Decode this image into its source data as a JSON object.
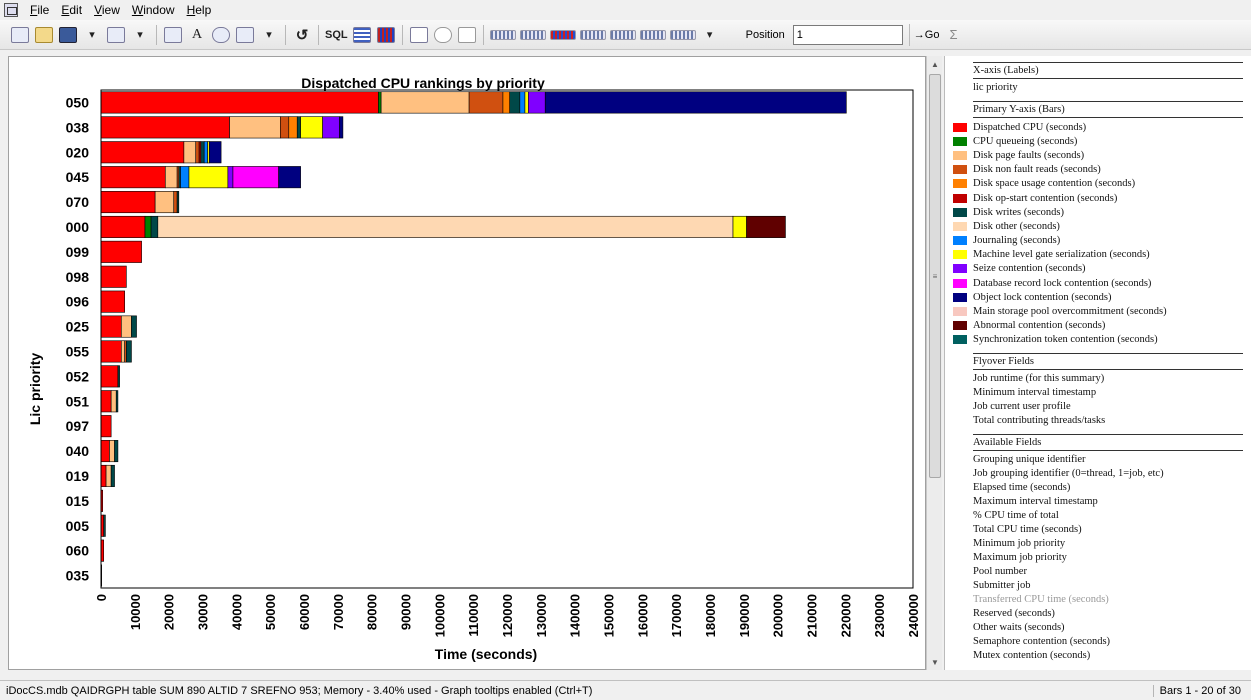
{
  "menu": [
    "File",
    "Edit",
    "View",
    "Window",
    "Help"
  ],
  "toolbar": {
    "sql_label": "SQL",
    "position_label": "Position",
    "position_value": "1",
    "go_label": "→Go",
    "sigma_label": "Σ"
  },
  "chart_data": {
    "type": "bar",
    "orientation": "horizontal",
    "stacked": true,
    "title": "Dispatched CPU rankings by priority",
    "xlabel": "Time (seconds)",
    "ylabel": "Lic priority",
    "xlim": [
      0,
      240000
    ],
    "x_ticks": [
      0,
      10000,
      20000,
      30000,
      40000,
      50000,
      60000,
      70000,
      80000,
      90000,
      100000,
      110000,
      120000,
      130000,
      140000,
      150000,
      160000,
      170000,
      180000,
      190000,
      200000,
      210000,
      220000,
      230000,
      240000
    ],
    "categories": [
      "050",
      "038",
      "020",
      "045",
      "070",
      "000",
      "099",
      "098",
      "096",
      "025",
      "055",
      "052",
      "051",
      "097",
      "040",
      "019",
      "015",
      "005",
      "060",
      "035"
    ],
    "series": [
      {
        "name": "Dispatched CPU (seconds)",
        "color": "#ff0000",
        "values": [
          82000,
          38000,
          24500,
          19000,
          16000,
          13000,
          12000,
          7500,
          7000,
          6000,
          6000,
          5000,
          3000,
          3000,
          2500,
          1500,
          500,
          800,
          800,
          200
        ]
      },
      {
        "name": "CPU queueing (seconds)",
        "color": "#008000",
        "values": [
          800,
          0,
          0,
          0,
          0,
          1800,
          0,
          0,
          0,
          0,
          0,
          0,
          0,
          0,
          0,
          0,
          0,
          0,
          0,
          0
        ]
      },
      {
        "name": "Disk page faults (seconds)",
        "color": "#ffc080",
        "values": [
          26000,
          15000,
          3500,
          3500,
          5500,
          0,
          0,
          0,
          0,
          3000,
          1000,
          0,
          1500,
          0,
          1500,
          1500,
          0,
          0,
          0,
          0
        ]
      },
      {
        "name": "Disk non fault reads (seconds)",
        "color": "#d05010",
        "values": [
          10000,
          2500,
          1000,
          500,
          1000,
          0,
          0,
          0,
          0,
          0,
          500,
          0,
          0,
          0,
          0,
          0,
          0,
          0,
          0,
          0
        ]
      },
      {
        "name": "Disk space usage contention (seconds)",
        "color": "#ff8000",
        "values": [
          2000,
          2500,
          0,
          0,
          0,
          0,
          0,
          0,
          0,
          0,
          0,
          0,
          0,
          0,
          0,
          0,
          0,
          0,
          0,
          0
        ]
      },
      {
        "name": "Disk op-start contention (seconds)",
        "color": "#c00000",
        "values": [
          0,
          0,
          500,
          0,
          0,
          0,
          0,
          0,
          0,
          0,
          0,
          0,
          0,
          0,
          0,
          0,
          0,
          0,
          0,
          0
        ]
      },
      {
        "name": "Disk writes (seconds)",
        "color": "#004848",
        "values": [
          3000,
          1000,
          1000,
          500,
          500,
          2000,
          0,
          0,
          0,
          1500,
          1500,
          500,
          500,
          0,
          1000,
          1000,
          0,
          500,
          0,
          0
        ]
      },
      {
        "name": "Disk other (seconds)",
        "color": "#fed8b2",
        "values": [
          0,
          0,
          0,
          0,
          0,
          170000,
          0,
          0,
          0,
          0,
          0,
          0,
          0,
          0,
          0,
          0,
          0,
          0,
          0,
          0
        ]
      },
      {
        "name": "Journaling (seconds)",
        "color": "#0080ff",
        "values": [
          1500,
          0,
          1000,
          2500,
          0,
          0,
          0,
          0,
          0,
          0,
          0,
          0,
          0,
          0,
          0,
          0,
          0,
          0,
          0,
          0
        ]
      },
      {
        "name": "Machine level gate serialization (seconds)",
        "color": "#ffff00",
        "values": [
          1000,
          6500,
          500,
          11500,
          0,
          4000,
          0,
          0,
          0,
          0,
          0,
          0,
          0,
          0,
          0,
          0,
          0,
          0,
          0,
          0
        ]
      },
      {
        "name": "Seize contention (seconds)",
        "color": "#8000ff",
        "values": [
          5000,
          5000,
          0,
          1500,
          0,
          0,
          0,
          0,
          0,
          0,
          0,
          0,
          0,
          0,
          0,
          0,
          0,
          0,
          0,
          0
        ]
      },
      {
        "name": "Database record lock contention (seconds)",
        "color": "#ff00ff",
        "values": [
          0,
          0,
          0,
          13500,
          0,
          0,
          0,
          0,
          0,
          0,
          0,
          0,
          0,
          0,
          0,
          0,
          0,
          0,
          0,
          0
        ]
      },
      {
        "name": "Object lock contention (seconds)",
        "color": "#000080",
        "values": [
          89000,
          1000,
          3500,
          6500,
          0,
          0,
          0,
          0,
          0,
          0,
          0,
          0,
          0,
          0,
          0,
          0,
          0,
          0,
          0,
          0
        ]
      },
      {
        "name": "Main storage pool overcommitment (seconds)",
        "color": "#f8c8c0",
        "values": [
          0,
          0,
          0,
          0,
          0,
          0,
          0,
          0,
          0,
          0,
          0,
          0,
          0,
          0,
          0,
          0,
          0,
          0,
          0,
          0
        ]
      },
      {
        "name": "Abnormal contention (seconds)",
        "color": "#600000",
        "values": [
          0,
          0,
          0,
          0,
          0,
          11500,
          0,
          0,
          0,
          0,
          0,
          0,
          0,
          0,
          0,
          0,
          0,
          0,
          0,
          0
        ]
      },
      {
        "name": "Synchronization token contention (seconds)",
        "color": "#006060",
        "values": [
          0,
          0,
          0,
          0,
          0,
          0,
          0,
          0,
          0,
          0,
          0,
          0,
          0,
          0,
          0,
          0,
          0,
          0,
          0,
          0
        ]
      }
    ]
  },
  "side_panel": {
    "xaxis_header": "X-axis (Labels)",
    "xaxis_value": "lic priority",
    "yaxis_header": "Primary Y-axis (Bars)",
    "flyover_header": "Flyover Fields",
    "flyover_fields": [
      "Job runtime (for this summary)",
      "Minimum interval timestamp",
      "Job current user profile",
      "Total contributing threads/tasks"
    ],
    "available_header": "Available Fields",
    "available_fields": [
      "Grouping unique identifier",
      "Job grouping identifier (0=thread, 1=job, etc)",
      "Elapsed time (seconds)",
      "Maximum interval timestamp",
      "% CPU time of total",
      "Total CPU time (seconds)",
      "Minimum job priority",
      "Maximum job priority",
      "Pool number",
      "Submitter job",
      "Transferred CPU time (seconds)",
      "Reserved (seconds)",
      "Other waits (seconds)",
      "Semaphore contention (seconds)",
      "Mutex contention (seconds)"
    ],
    "dimmed_field": "Transferred CPU time (seconds)"
  },
  "status": {
    "left": "iDocCS.mdb QAIDRGPH table SUM 890 ALTID 7 SREFNO 953; Memory - 3.40% used - Graph tooltips enabled (Ctrl+T)",
    "right": "Bars 1 - 20 of 30"
  }
}
